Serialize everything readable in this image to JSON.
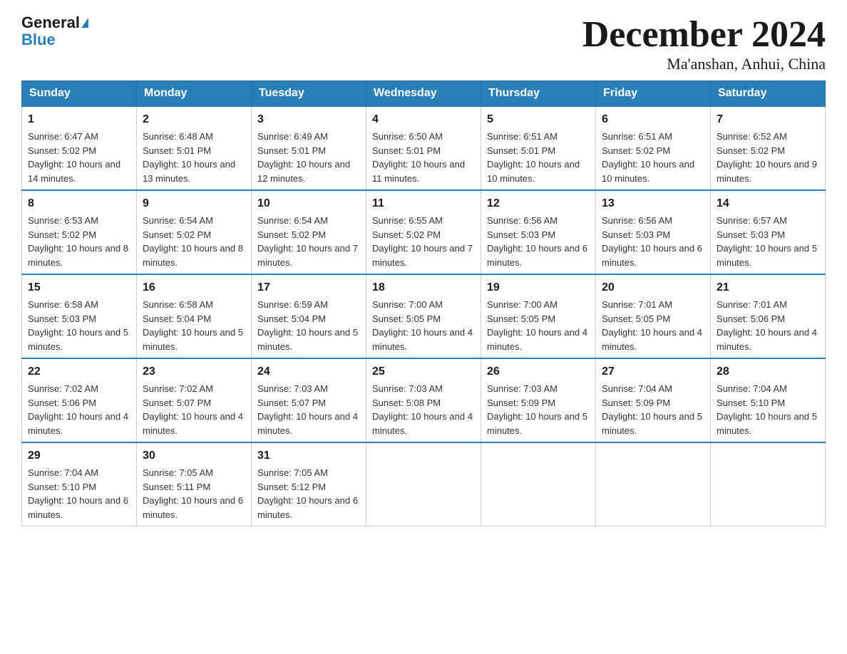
{
  "header": {
    "logo_general": "General",
    "logo_blue": "Blue",
    "title": "December 2024",
    "subtitle": "Ma'anshan, Anhui, China"
  },
  "days_of_week": [
    "Sunday",
    "Monday",
    "Tuesday",
    "Wednesday",
    "Thursday",
    "Friday",
    "Saturday"
  ],
  "weeks": [
    [
      {
        "day": "1",
        "sunrise": "6:47 AM",
        "sunset": "5:02 PM",
        "daylight": "10 hours and 14 minutes."
      },
      {
        "day": "2",
        "sunrise": "6:48 AM",
        "sunset": "5:01 PM",
        "daylight": "10 hours and 13 minutes."
      },
      {
        "day": "3",
        "sunrise": "6:49 AM",
        "sunset": "5:01 PM",
        "daylight": "10 hours and 12 minutes."
      },
      {
        "day": "4",
        "sunrise": "6:50 AM",
        "sunset": "5:01 PM",
        "daylight": "10 hours and 11 minutes."
      },
      {
        "day": "5",
        "sunrise": "6:51 AM",
        "sunset": "5:01 PM",
        "daylight": "10 hours and 10 minutes."
      },
      {
        "day": "6",
        "sunrise": "6:51 AM",
        "sunset": "5:02 PM",
        "daylight": "10 hours and 10 minutes."
      },
      {
        "day": "7",
        "sunrise": "6:52 AM",
        "sunset": "5:02 PM",
        "daylight": "10 hours and 9 minutes."
      }
    ],
    [
      {
        "day": "8",
        "sunrise": "6:53 AM",
        "sunset": "5:02 PM",
        "daylight": "10 hours and 8 minutes."
      },
      {
        "day": "9",
        "sunrise": "6:54 AM",
        "sunset": "5:02 PM",
        "daylight": "10 hours and 8 minutes."
      },
      {
        "day": "10",
        "sunrise": "6:54 AM",
        "sunset": "5:02 PM",
        "daylight": "10 hours and 7 minutes."
      },
      {
        "day": "11",
        "sunrise": "6:55 AM",
        "sunset": "5:02 PM",
        "daylight": "10 hours and 7 minutes."
      },
      {
        "day": "12",
        "sunrise": "6:56 AM",
        "sunset": "5:03 PM",
        "daylight": "10 hours and 6 minutes."
      },
      {
        "day": "13",
        "sunrise": "6:56 AM",
        "sunset": "5:03 PM",
        "daylight": "10 hours and 6 minutes."
      },
      {
        "day": "14",
        "sunrise": "6:57 AM",
        "sunset": "5:03 PM",
        "daylight": "10 hours and 5 minutes."
      }
    ],
    [
      {
        "day": "15",
        "sunrise": "6:58 AM",
        "sunset": "5:03 PM",
        "daylight": "10 hours and 5 minutes."
      },
      {
        "day": "16",
        "sunrise": "6:58 AM",
        "sunset": "5:04 PM",
        "daylight": "10 hours and 5 minutes."
      },
      {
        "day": "17",
        "sunrise": "6:59 AM",
        "sunset": "5:04 PM",
        "daylight": "10 hours and 5 minutes."
      },
      {
        "day": "18",
        "sunrise": "7:00 AM",
        "sunset": "5:05 PM",
        "daylight": "10 hours and 4 minutes."
      },
      {
        "day": "19",
        "sunrise": "7:00 AM",
        "sunset": "5:05 PM",
        "daylight": "10 hours and 4 minutes."
      },
      {
        "day": "20",
        "sunrise": "7:01 AM",
        "sunset": "5:05 PM",
        "daylight": "10 hours and 4 minutes."
      },
      {
        "day": "21",
        "sunrise": "7:01 AM",
        "sunset": "5:06 PM",
        "daylight": "10 hours and 4 minutes."
      }
    ],
    [
      {
        "day": "22",
        "sunrise": "7:02 AM",
        "sunset": "5:06 PM",
        "daylight": "10 hours and 4 minutes."
      },
      {
        "day": "23",
        "sunrise": "7:02 AM",
        "sunset": "5:07 PM",
        "daylight": "10 hours and 4 minutes."
      },
      {
        "day": "24",
        "sunrise": "7:03 AM",
        "sunset": "5:07 PM",
        "daylight": "10 hours and 4 minutes."
      },
      {
        "day": "25",
        "sunrise": "7:03 AM",
        "sunset": "5:08 PM",
        "daylight": "10 hours and 4 minutes."
      },
      {
        "day": "26",
        "sunrise": "7:03 AM",
        "sunset": "5:09 PM",
        "daylight": "10 hours and 5 minutes."
      },
      {
        "day": "27",
        "sunrise": "7:04 AM",
        "sunset": "5:09 PM",
        "daylight": "10 hours and 5 minutes."
      },
      {
        "day": "28",
        "sunrise": "7:04 AM",
        "sunset": "5:10 PM",
        "daylight": "10 hours and 5 minutes."
      }
    ],
    [
      {
        "day": "29",
        "sunrise": "7:04 AM",
        "sunset": "5:10 PM",
        "daylight": "10 hours and 6 minutes."
      },
      {
        "day": "30",
        "sunrise": "7:05 AM",
        "sunset": "5:11 PM",
        "daylight": "10 hours and 6 minutes."
      },
      {
        "day": "31",
        "sunrise": "7:05 AM",
        "sunset": "5:12 PM",
        "daylight": "10 hours and 6 minutes."
      },
      null,
      null,
      null,
      null
    ]
  ]
}
